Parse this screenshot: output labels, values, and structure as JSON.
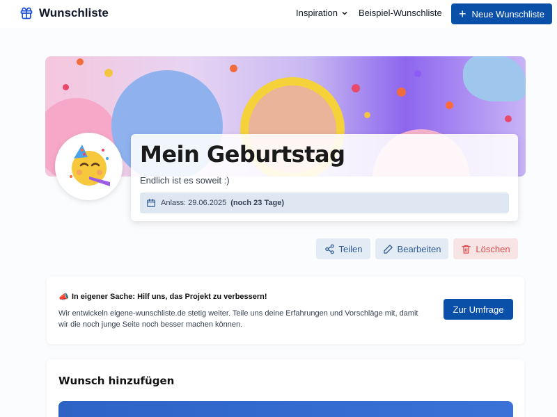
{
  "nav": {
    "brand": "Wunschliste",
    "links": [
      "Inspiration",
      "Beispiel-Wunschliste"
    ],
    "new_button": "Neue Wunschliste"
  },
  "wishlist": {
    "title": "Mein Geburtstag",
    "subtitle": "Endlich ist es soweit :)",
    "occasion_label": "Anlass: 29.06.2025",
    "countdown": "(noch 23 Tage)",
    "avatar_emoji": "🥳"
  },
  "actions": {
    "share": "Teilen",
    "edit": "Bearbeiten",
    "delete": "Löschen"
  },
  "survey": {
    "icon": "📣",
    "heading": "In eigener Sache: Hilf uns, das Projekt zu verbessern!",
    "text": "Wir entwickeln eigene-wunschliste.de stetig weiter. Teile uns deine Erfahrungen und Vorschläge mit, damit wir die noch junge Seite noch besser machen können.",
    "button": "Zur Umfrage"
  },
  "add_wish": {
    "heading": "Wunsch hinzufügen"
  },
  "colors": {
    "primary": "#0a4fa8",
    "soft_blue": "#e3ebf5",
    "danger": "#dc4c4c",
    "soft_red": "#f8e4e4"
  }
}
